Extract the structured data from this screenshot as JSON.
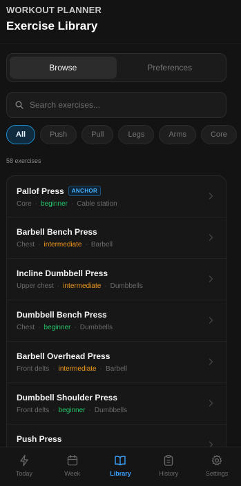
{
  "header": {
    "app_name": "WORKOUT PLANNER",
    "title": "Exercise Library"
  },
  "segments": [
    {
      "label": "Browse",
      "active": true
    },
    {
      "label": "Preferences",
      "active": false
    }
  ],
  "search": {
    "placeholder": "Search exercises...",
    "value": ""
  },
  "filters": [
    {
      "label": "All",
      "active": true
    },
    {
      "label": "Push",
      "active": false
    },
    {
      "label": "Pull",
      "active": false
    },
    {
      "label": "Legs",
      "active": false
    },
    {
      "label": "Arms",
      "active": false
    },
    {
      "label": "Core",
      "active": false
    }
  ],
  "count_text": "58 exercises",
  "exercises": [
    {
      "name": "Pallof Press",
      "badge": "ANCHOR",
      "target": "Core",
      "level": "beginner",
      "equipment": "Cable station"
    },
    {
      "name": "Barbell Bench Press",
      "badge": "",
      "target": "Chest",
      "level": "intermediate",
      "equipment": "Barbell"
    },
    {
      "name": "Incline Dumbbell Press",
      "badge": "",
      "target": "Upper chest",
      "level": "intermediate",
      "equipment": "Dumbbells"
    },
    {
      "name": "Dumbbell Bench Press",
      "badge": "",
      "target": "Chest",
      "level": "beginner",
      "equipment": "Dumbbells"
    },
    {
      "name": "Barbell Overhead Press",
      "badge": "",
      "target": "Front delts",
      "level": "intermediate",
      "equipment": "Barbell"
    },
    {
      "name": "Dumbbell Shoulder Press",
      "badge": "",
      "target": "Front delts",
      "level": "beginner",
      "equipment": "Dumbbells"
    },
    {
      "name": "Push Press",
      "badge": "",
      "target": "",
      "level": "",
      "equipment": ""
    }
  ],
  "tabs": [
    {
      "label": "Today",
      "icon": "bolt-icon",
      "active": false
    },
    {
      "label": "Week",
      "icon": "calendar-icon",
      "active": false
    },
    {
      "label": "Library",
      "icon": "book-icon",
      "active": true
    },
    {
      "label": "History",
      "icon": "clipboard-icon",
      "active": false
    },
    {
      "label": "Settings",
      "icon": "gear-icon",
      "active": false
    }
  ],
  "colors": {
    "accent": "#3aa3ff",
    "beginner": "#24c46a",
    "intermediate": "#f29a1c",
    "badge": "#4ab4ff"
  }
}
